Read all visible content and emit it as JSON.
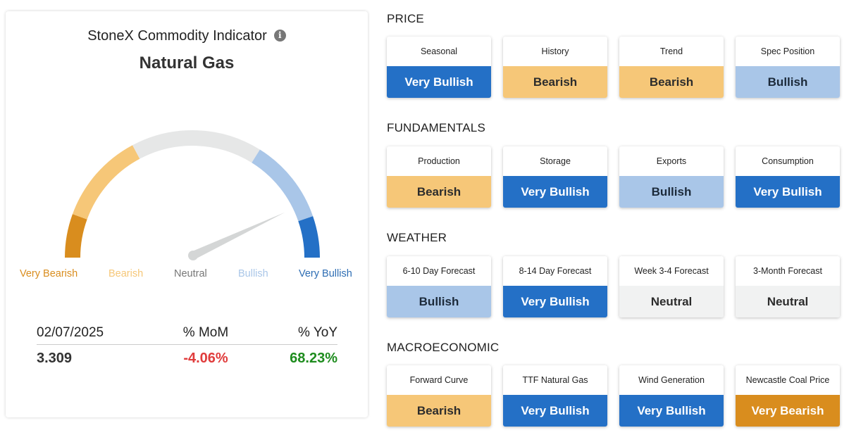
{
  "indicator": {
    "title": "StoneX Commodity Indicator",
    "info_icon": "info-icon",
    "commodity": "Natural Gas",
    "gauge_level": 0.86,
    "gauge_labels": {
      "very_bearish": "Very Bearish",
      "bearish": "Bearish",
      "neutral": "Neutral",
      "bullish": "Bullish",
      "very_bullish": "Very Bullish"
    },
    "stats": {
      "date": "02/07/2025",
      "mom_header": "% MoM",
      "yoy_header": "% YoY",
      "value": "3.309",
      "mom": "-4.06%",
      "yoy": "68.23%"
    }
  },
  "colors": {
    "very_bullish": "#2470c6",
    "bullish": "#a9c6e8",
    "neutral": "#e6e7e7",
    "bearish": "#f6c778",
    "very_bearish": "#d98d1e",
    "negative": "#e03c3c",
    "positive": "#1e8c1e"
  },
  "sections": [
    {
      "title": "PRICE",
      "tiles": [
        {
          "label": "Seasonal",
          "value": "Very Bullish",
          "level": "vb"
        },
        {
          "label": "History",
          "value": "Bearish",
          "level": "be"
        },
        {
          "label": "Trend",
          "value": "Bearish",
          "level": "be"
        },
        {
          "label": "Spec Position",
          "value": "Bullish",
          "level": "b"
        }
      ]
    },
    {
      "title": "FUNDAMENTALS",
      "tiles": [
        {
          "label": "Production",
          "value": "Bearish",
          "level": "be"
        },
        {
          "label": "Storage",
          "value": "Very Bullish",
          "level": "vb"
        },
        {
          "label": "Exports",
          "value": "Bullish",
          "level": "b"
        },
        {
          "label": "Consumption",
          "value": "Very Bullish",
          "level": "vb"
        }
      ]
    },
    {
      "title": "WEATHER",
      "tiles": [
        {
          "label": "6-10 Day Forecast",
          "value": "Bullish",
          "level": "b"
        },
        {
          "label": "8-14 Day Forecast",
          "value": "Very Bullish",
          "level": "vb"
        },
        {
          "label": "Week 3-4 Forecast",
          "value": "Neutral",
          "level": "n"
        },
        {
          "label": "3-Month Forecast",
          "value": "Neutral",
          "level": "n"
        }
      ]
    },
    {
      "title": "MACROECONOMIC",
      "tiles": [
        {
          "label": "Forward Curve",
          "value": "Bearish",
          "level": "be"
        },
        {
          "label": "TTF Natural Gas",
          "value": "Very Bullish",
          "level": "vb"
        },
        {
          "label": "Wind Generation",
          "value": "Very Bullish",
          "level": "vb"
        },
        {
          "label": "Newcastle Coal Price",
          "value": "Very Bearish",
          "level": "vbe"
        }
      ]
    }
  ]
}
